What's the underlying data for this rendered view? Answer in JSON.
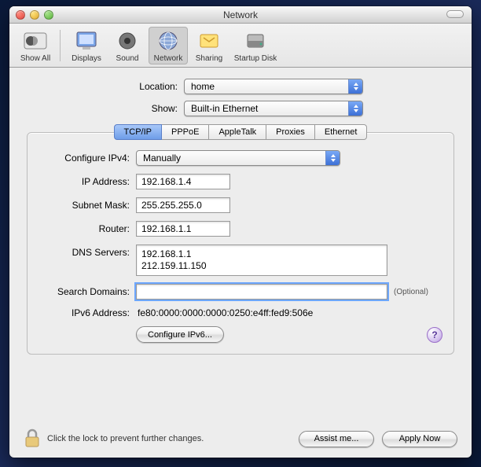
{
  "window": {
    "title": "Network"
  },
  "toolbar": {
    "items": [
      {
        "label": "Show All"
      },
      {
        "label": "Displays"
      },
      {
        "label": "Sound"
      },
      {
        "label": "Network"
      },
      {
        "label": "Sharing"
      },
      {
        "label": "Startup Disk"
      }
    ]
  },
  "selectors": {
    "location_label": "Location:",
    "location_value": "home",
    "show_label": "Show:",
    "show_value": "Built-in Ethernet"
  },
  "tabs": {
    "items": [
      "TCP/IP",
      "PPPoE",
      "AppleTalk",
      "Proxies",
      "Ethernet"
    ],
    "selected": "TCP/IP"
  },
  "tcpip": {
    "configure_label": "Configure IPv4:",
    "configure_value": "Manually",
    "ip_label": "IP Address:",
    "ip_value": "192.168.1.4",
    "subnet_label": "Subnet Mask:",
    "subnet_value": "255.255.255.0",
    "router_label": "Router:",
    "router_value": "192.168.1.1",
    "dns_label": "DNS Servers:",
    "dns_value": "192.168.1.1\n212.159.11.150",
    "search_label": "Search Domains:",
    "search_value": "",
    "optional_text": "(Optional)",
    "ipv6_label": "IPv6 Address:",
    "ipv6_value": "fe80:0000:0000:0000:0250:e4ff:fed9:506e",
    "configure_ipv6_btn": "Configure IPv6...",
    "help_btn": "?"
  },
  "footer": {
    "lock_text": "Click the lock to prevent further changes.",
    "assist_btn": "Assist me...",
    "apply_btn": "Apply Now"
  }
}
